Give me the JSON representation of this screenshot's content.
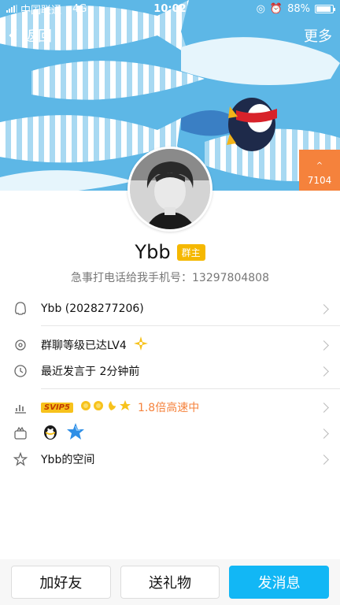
{
  "status_bar": {
    "carrier": "中国联通",
    "network": "4G",
    "time": "10:02",
    "battery": "88%",
    "battery_level": 0.88
  },
  "nav": {
    "back_label": "返回",
    "more_label": "更多"
  },
  "cover": {
    "badge_count": "7104",
    "colors": {
      "sky": "#5db7e6",
      "stripe": "#ffffff",
      "accent": "#f5823c"
    }
  },
  "profile": {
    "name": "Ybb",
    "owner_tag": "群主",
    "subtitle": "急事打电话给我手机号：13297804808"
  },
  "list": {
    "qq_row": {
      "icon": "penguin-outline-icon",
      "text": "Ybb (2028277206)"
    },
    "level_row": {
      "icon": "gear-star-icon",
      "text": "群聊等级已达LV4",
      "badge_icon": "level-star-icon"
    },
    "recent_row": {
      "icon": "clock-icon",
      "text": "最近发言于 2分钟前"
    },
    "vip_row": {
      "icon": "growth-chart-icon",
      "svip_tag": "SVIP5",
      "speed_text": "1.8倍高速中"
    },
    "crown_row": {
      "icon": "crown-box-icon"
    },
    "space_row": {
      "icon": "star-outline-icon",
      "text": "Ybb的空间"
    }
  },
  "bottom": {
    "add_friend": "加好友",
    "send_gift": "送礼物",
    "send_message": "发消息"
  }
}
